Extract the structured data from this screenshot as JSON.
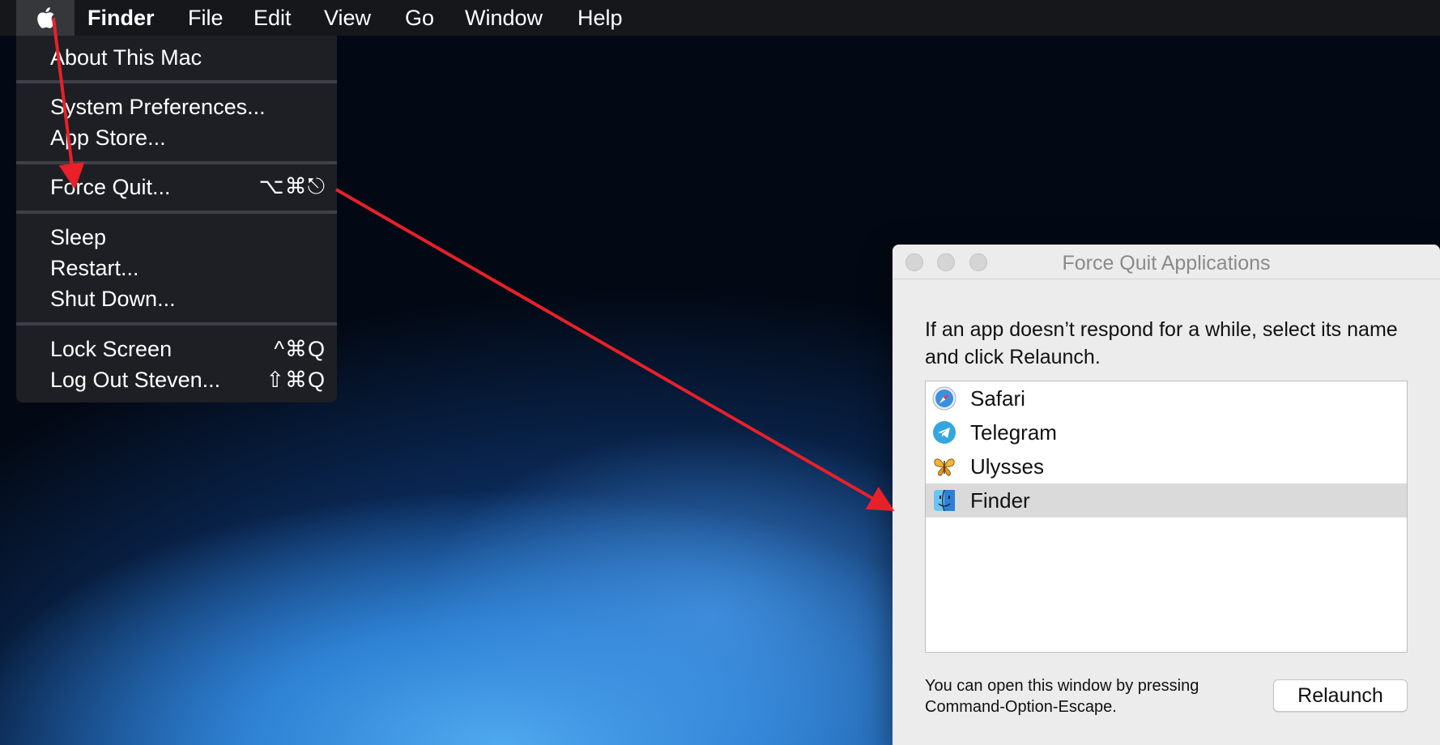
{
  "menubar": {
    "app_name": "Finder",
    "items": [
      "File",
      "Edit",
      "View",
      "Go",
      "Window",
      "Help"
    ]
  },
  "apple_menu": {
    "about": "About This Mac",
    "system_prefs": "System Preferences...",
    "app_store": "App Store...",
    "force_quit": "Force Quit...",
    "force_quit_shortcut": "⌥⌘⎋",
    "sleep": "Sleep",
    "restart": "Restart...",
    "shut_down": "Shut Down...",
    "lock_screen": "Lock Screen",
    "lock_screen_shortcut": "^⌘Q",
    "log_out": "Log Out Steven...",
    "log_out_shortcut": "⇧⌘Q"
  },
  "force_quit_window": {
    "title": "Force Quit Applications",
    "description": "If an app doesn’t respond for a while, select its name and click Relaunch.",
    "apps": [
      {
        "name": "Safari",
        "icon": "safari-icon"
      },
      {
        "name": "Telegram",
        "icon": "telegram-icon"
      },
      {
        "name": "Ulysses",
        "icon": "ulysses-butterfly-icon"
      },
      {
        "name": "Finder",
        "icon": "finder-icon",
        "selected": true
      }
    ],
    "hint": "You can open this window by pressing Command-Option-Escape.",
    "relaunch_label": "Relaunch"
  },
  "annotation_color": "#e8202a"
}
